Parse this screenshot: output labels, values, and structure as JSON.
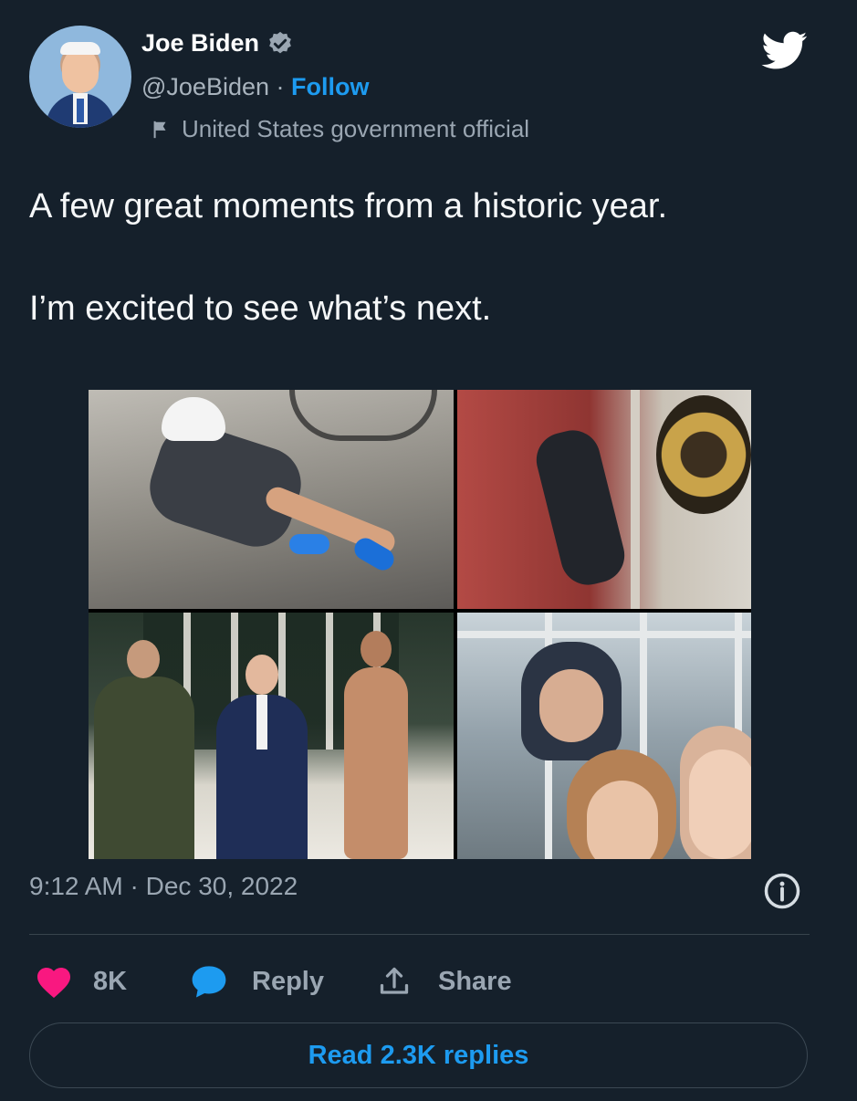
{
  "author": {
    "name": "Joe Biden",
    "handle": "@JoeBiden",
    "separator": "·",
    "follow_label": "Follow",
    "label": "United States government official"
  },
  "icons": {
    "verified": "verified-badge-icon",
    "bird": "twitter-bird-icon",
    "flag": "flag-icon",
    "info": "info-icon",
    "like": "heart-icon",
    "reply": "reply-bubble-icon",
    "share": "share-icon"
  },
  "tweet": {
    "text_line1": "A few great moments from a historic year.",
    "text_line2": "I’m excited to see what’s next."
  },
  "meta": {
    "time": "9:12 AM",
    "separator": "·",
    "date": "Dec 30, 2022"
  },
  "actions": {
    "like_count": "8K",
    "reply_label": "Reply",
    "share_label": "Share"
  },
  "read_replies_label": "Read 2.3K replies",
  "colors": {
    "background": "#15202b",
    "accent": "#1d9bf0",
    "like": "#f91880",
    "muted": "#9aa6b2"
  }
}
